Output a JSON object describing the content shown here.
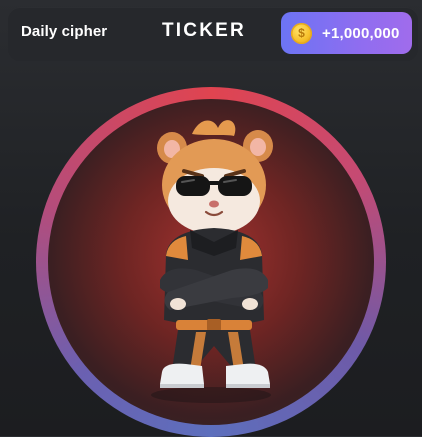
{
  "header": {
    "daily_cipher_label": "Daily cipher",
    "title": "TICKER",
    "reward_amount": "+1,000,000",
    "coin_symbol": "$"
  },
  "icons": {
    "coin": "coin-icon",
    "character": "hamster-character"
  },
  "colors": {
    "background": "#1f2124",
    "top_bar": "#26282c",
    "reward_gradient_start": "#6c74f4",
    "reward_gradient_end": "#a06cec",
    "coin": "#f7c12c",
    "ring_red": "#e04450",
    "ring_blue": "#5d6fbd"
  }
}
